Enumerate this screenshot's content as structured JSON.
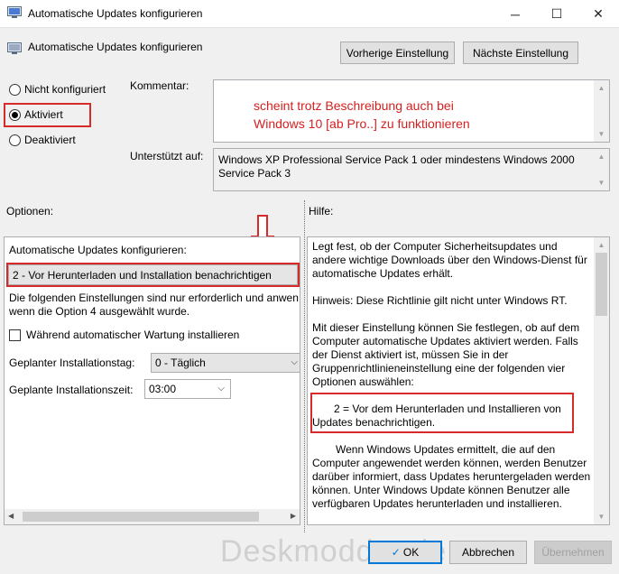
{
  "window": {
    "title": "Automatische Updates konfigurieren",
    "minimize": "─",
    "maximize": "☐",
    "close": "✕"
  },
  "header": {
    "title": "Automatische Updates konfigurieren",
    "prev_button": "Vorherige Einstellung",
    "next_button": "Nächste Einstellung"
  },
  "state": {
    "options": [
      {
        "label": "Nicht konfiguriert",
        "selected": false
      },
      {
        "label": "Aktiviert",
        "selected": true
      },
      {
        "label": "Deaktiviert",
        "selected": false
      }
    ]
  },
  "comment": {
    "label": "Kommentar:",
    "lines": [
      "scheint trotz Beschreibung auch bei",
      "Windows 10 [ab Pro..] zu funktionieren"
    ]
  },
  "supported": {
    "label": "Unterstützt auf:",
    "text": "Windows XP Professional Service Pack 1 oder mindestens Windows 2000 Service Pack 3"
  },
  "options_pane": {
    "label": "Optionen:",
    "configure_label": "Automatische Updates konfigurieren:",
    "configure_value": "2 - Vor Herunterladen und Installation benachrichtigen",
    "note": "Die folgenden Einstellungen sind nur erforderlich und anwen wenn die Option 4 ausgewählt wurde.",
    "maintenance_checkbox": "Während automatischer Wartung installieren",
    "day_label": "Geplanter Installationstag:",
    "day_value": "0 - Täglich",
    "time_label": "Geplante Installationszeit:",
    "time_value": "03:00"
  },
  "help_pane": {
    "label": "Hilfe:",
    "p1": "Legt fest, ob der Computer Sicherheitsupdates und andere wichtige Downloads über den Windows-Dienst für automatische Updates erhält.",
    "p2": "Hinweis: Diese Richtlinie gilt nicht unter Windows RT.",
    "p3": "Mit dieser Einstellung können Sie festlegen, ob auf dem Computer automatische Updates aktiviert werden. Falls der Dienst aktiviert ist, müssen Sie in der Gruppenrichtlinieneinstellung eine der folgenden vier Optionen auswählen:",
    "p4_line1": "2 = Vor dem Herunterladen und Installieren von",
    "p4_line2": "Updates benachrichtigen.",
    "p5": "Wenn Windows Updates ermittelt, die auf den Computer angewendet werden können, werden Benutzer darüber informiert, dass Updates heruntergeladen werden können. Unter Windows Update können Benutzer alle verfügbaren Updates herunterladen und installieren."
  },
  "footer": {
    "watermark": "Deskmodder.de",
    "ok": "OK",
    "cancel": "Abbrechen",
    "apply": "Übernehmen"
  },
  "colors": {
    "highlight_red": "#d72a2a",
    "comment_text": "#d42020",
    "accent_blue": "#0078d7"
  },
  "icons": [
    "policy-icon",
    "minimize-icon",
    "maximize-icon",
    "close-icon",
    "down-arrow-annotation-icon",
    "chevron-down-icon",
    "ok-icon"
  ]
}
